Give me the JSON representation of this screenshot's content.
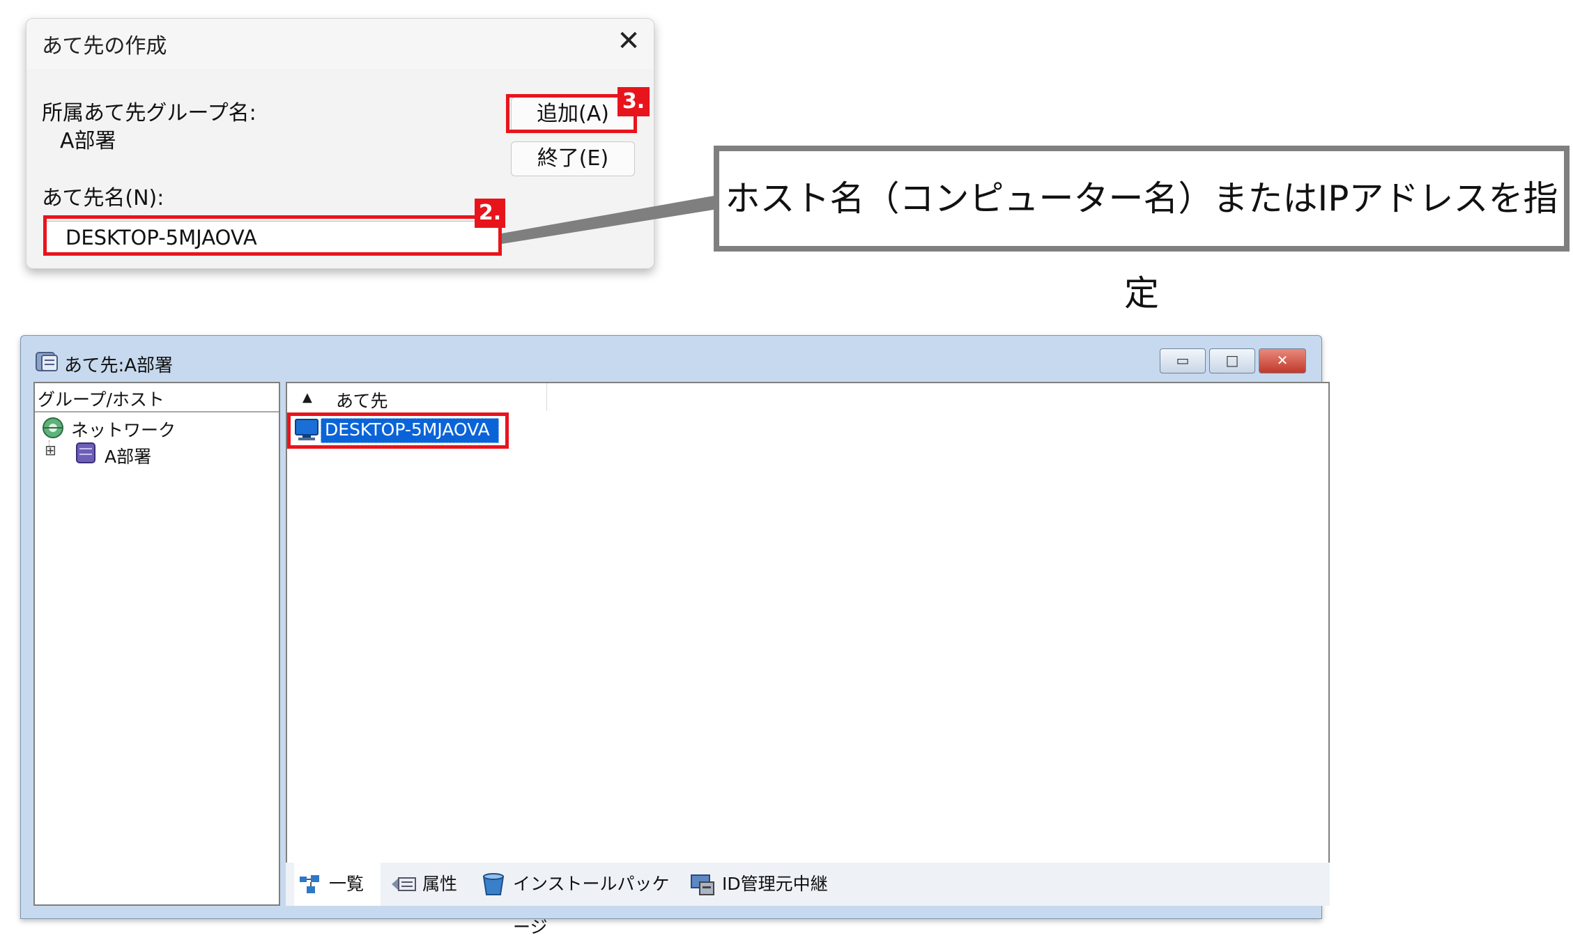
{
  "dialog": {
    "title": "あて先の作成",
    "close_glyph": "✕",
    "group_label": "所属あて先グループ名:",
    "group_value": "A部署",
    "dest_label": "あて先名(N):",
    "dest_value": "DESKTOP-5MJAOVA",
    "add_button": "追加(A)",
    "end_button": "終了(E)",
    "badge_add": "3.",
    "badge_input": "2."
  },
  "callout": {
    "text": "ホスト名（コンピューター名）またはIPアドレスを指定"
  },
  "window": {
    "title": "あて先:A部署",
    "btn_minimize": "▭",
    "btn_maximize": "□",
    "btn_close": "✕",
    "tree_header": "グループ/ホスト",
    "tree_items": [
      {
        "label": "ネットワーク",
        "icon": "network-globe-icon"
      },
      {
        "label": "A部署",
        "icon": "group-folder-icon",
        "expander": "⊞"
      }
    ],
    "list_sort_glyph": "▲",
    "list_header": "あて先",
    "list_items": [
      {
        "label": "DESKTOP-5MJAOVA",
        "icon": "computer-icon",
        "selected": true
      }
    ],
    "tabs": [
      {
        "label": "一覧",
        "icon": "list-view-icon",
        "active": true
      },
      {
        "label": "属性",
        "icon": "attribute-icon"
      },
      {
        "label": "インストールパッケージ",
        "icon": "install-package-icon"
      },
      {
        "label": "ID管理元中継",
        "icon": "id-relay-icon"
      }
    ]
  },
  "colors": {
    "highlight_red": "#e8141c",
    "selection_blue": "#0a64d8",
    "window_frame": "#c7d9ee"
  }
}
